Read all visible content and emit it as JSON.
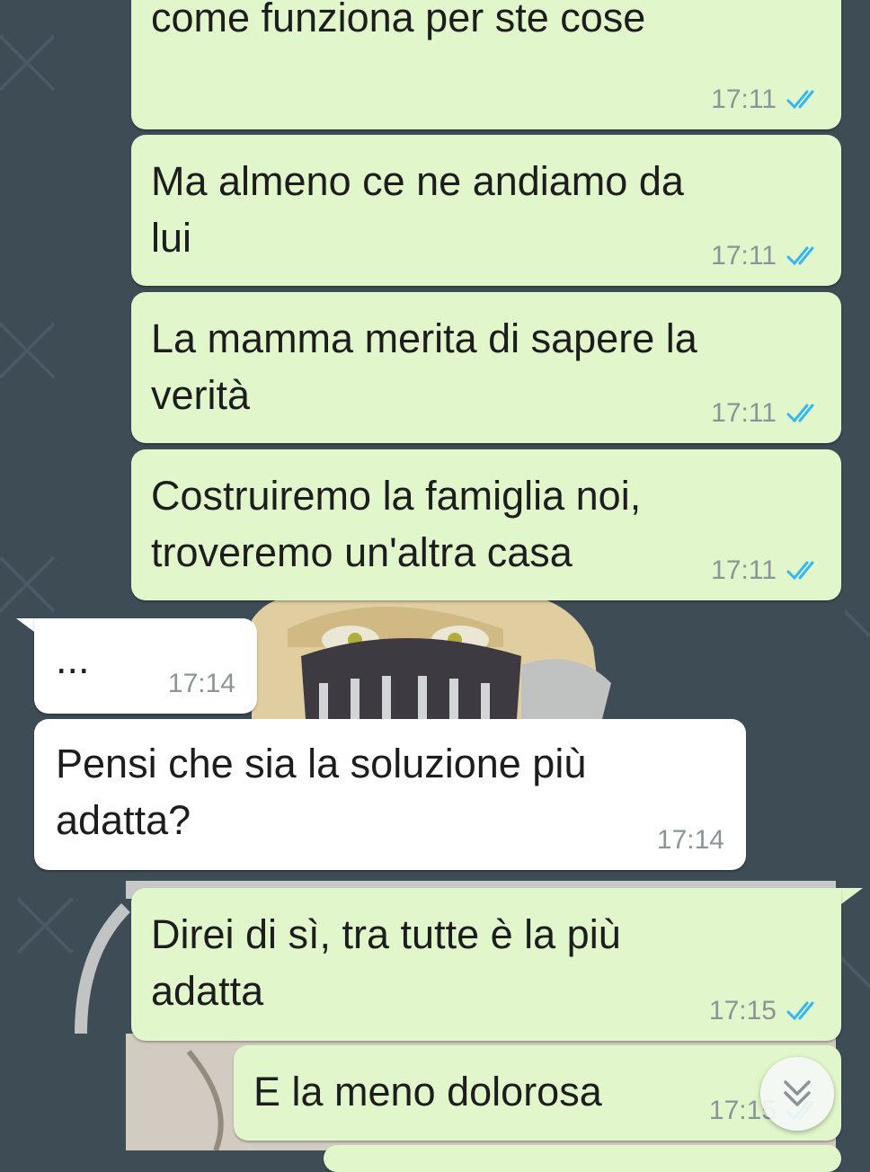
{
  "chat": {
    "messages": [
      {
        "direction": "outgoing",
        "text": "come funziona per ste cose",
        "time": "17:11",
        "status": "read"
      },
      {
        "direction": "outgoing",
        "text": "Ma almeno ce ne andiamo da\nlui",
        "time": "17:11",
        "status": "read"
      },
      {
        "direction": "outgoing",
        "text": "La mamma merita di sapere la\nverità",
        "time": "17:11",
        "status": "read"
      },
      {
        "direction": "outgoing",
        "text": "Costruiremo la famiglia noi,\ntroveremo un'altra casa",
        "time": "17:11",
        "status": "read"
      },
      {
        "direction": "incoming",
        "text": "...",
        "time": "17:14"
      },
      {
        "direction": "incoming",
        "text": "Pensi che sia la soluzione più\nadatta?",
        "time": "17:14"
      },
      {
        "direction": "outgoing",
        "text": "Direi di sì, tra tutte è la più\nadatta",
        "time": "17:15",
        "status": "read"
      },
      {
        "direction": "outgoing",
        "text": "E la meno dolorosa",
        "time": "17:15",
        "status": "read"
      }
    ]
  },
  "icons": {
    "read_receipt": "double-check-icon",
    "scroll_down": "double-chevron-down-icon"
  },
  "colors": {
    "background": "#3d4c55",
    "outgoing_bubble": "#e1f7cb",
    "incoming_bubble": "#ffffff",
    "read_tick": "#34b7f1",
    "timestamp": "#8c9497"
  }
}
